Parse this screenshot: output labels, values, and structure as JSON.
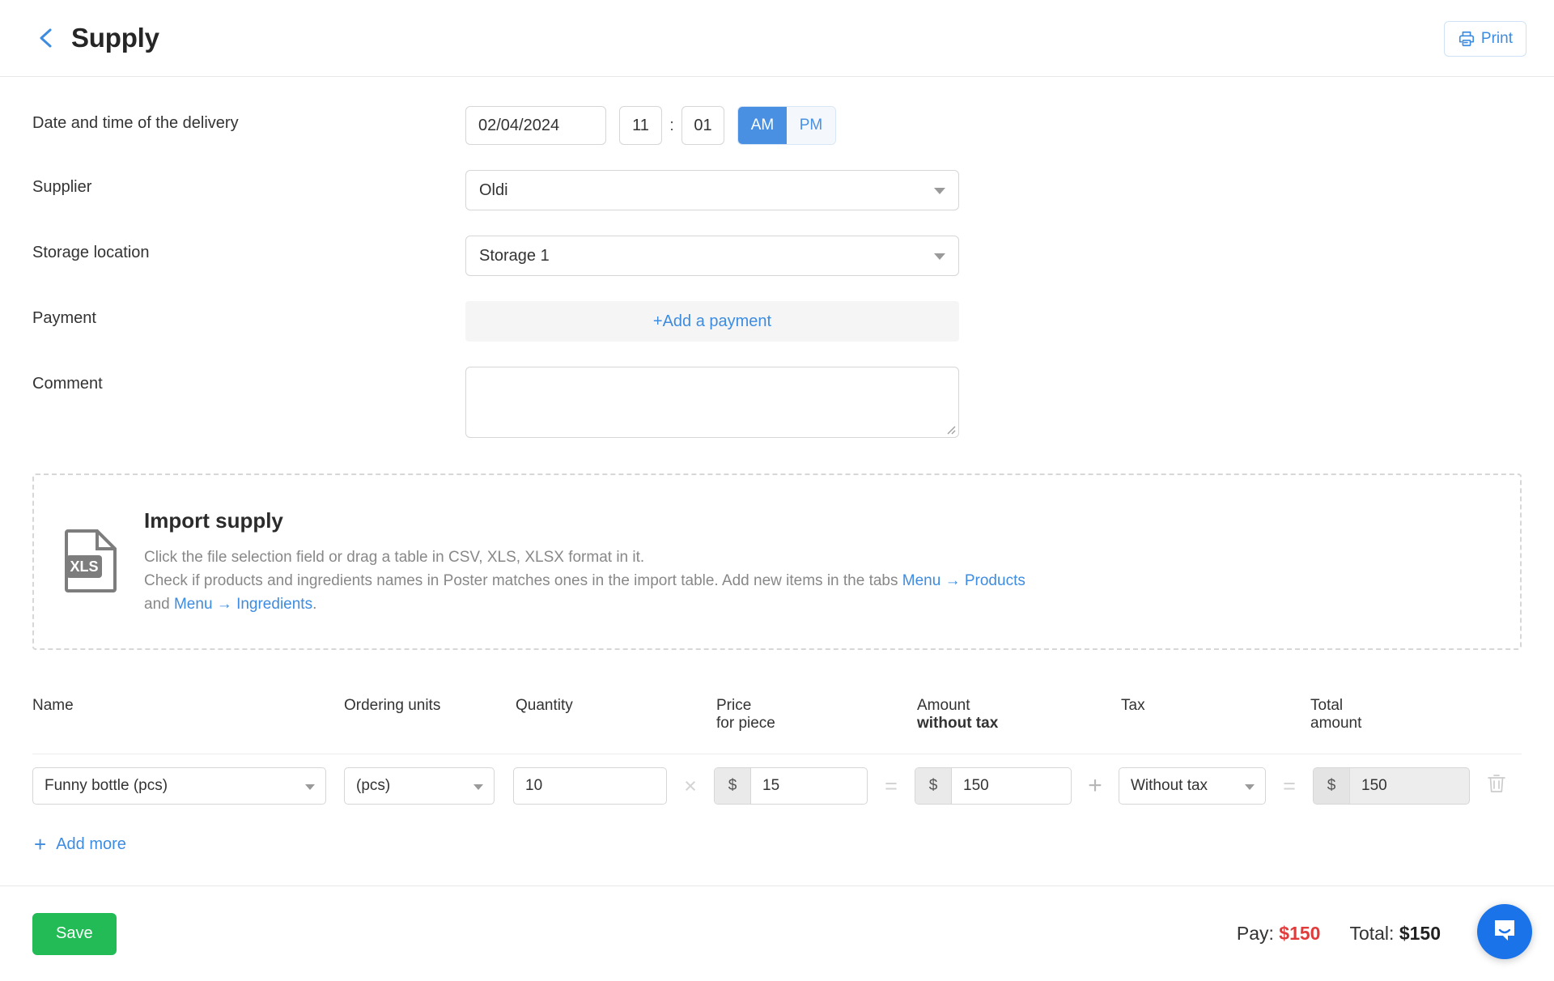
{
  "header": {
    "back_icon": "chevron-left-icon",
    "title": "Supply",
    "print_label": "Print",
    "print_icon": "printer-icon",
    "accent_blue": "#3d8ce0"
  },
  "form": {
    "datetime": {
      "label": "Date and time of the delivery",
      "date": "02/04/2024",
      "hour": "11",
      "separator": ":",
      "minute": "01",
      "am_label": "AM",
      "pm_label": "PM",
      "meridiem_selected": "AM",
      "active_color": "#4a90e2"
    },
    "supplier": {
      "label": "Supplier",
      "value": "Oldi"
    },
    "storage": {
      "label": "Storage location",
      "value": "Storage 1"
    },
    "payment": {
      "label": "Payment",
      "action_label": "+Add a payment"
    },
    "comment": {
      "label": "Comment",
      "value": "",
      "placeholder": ""
    }
  },
  "import": {
    "icon": "xls-file-icon",
    "icon_badge": "XLS",
    "title": "Import supply",
    "line1": "Click the file selection field or drag a table in CSV, XLS, XLSX format in it.",
    "line2_part1": "Check if products and ingredients names in Poster matches ones in the import table. Add new items in the tabs ",
    "link1": "Menu → Products",
    "line2_mid": " and ",
    "link2": "Menu → Ingredients",
    "line2_end": "."
  },
  "table": {
    "headers": {
      "name": "Name",
      "units": "Ordering units",
      "quantity": "Quantity",
      "price_top": "Price",
      "price_sub": "for piece",
      "amount_top": "Amount",
      "amount_sub": "without tax",
      "tax": "Tax",
      "total_top": "Total",
      "total_sub": "amount"
    },
    "operators": {
      "multiply": "×",
      "equals": "=",
      "plus": "+"
    },
    "rows": [
      {
        "name": "Funny bottle (pcs)",
        "units": "(pcs)",
        "quantity": "10",
        "currency": "$",
        "price": "15",
        "amount": "150",
        "tax": "Without tax",
        "total": "150",
        "delete_icon": "trash-icon"
      }
    ],
    "add_more_label": "Add more",
    "add_more_icon": "plus-icon"
  },
  "footer": {
    "save_label": "Save",
    "save_color": "#22bb55",
    "pay_label": "Pay:",
    "pay_value": "$150",
    "pay_color": "#e23b3b",
    "total_label": "Total:",
    "total_value": "$150"
  },
  "chat": {
    "icon": "chat-bubble-icon",
    "color": "#1a73e8"
  }
}
